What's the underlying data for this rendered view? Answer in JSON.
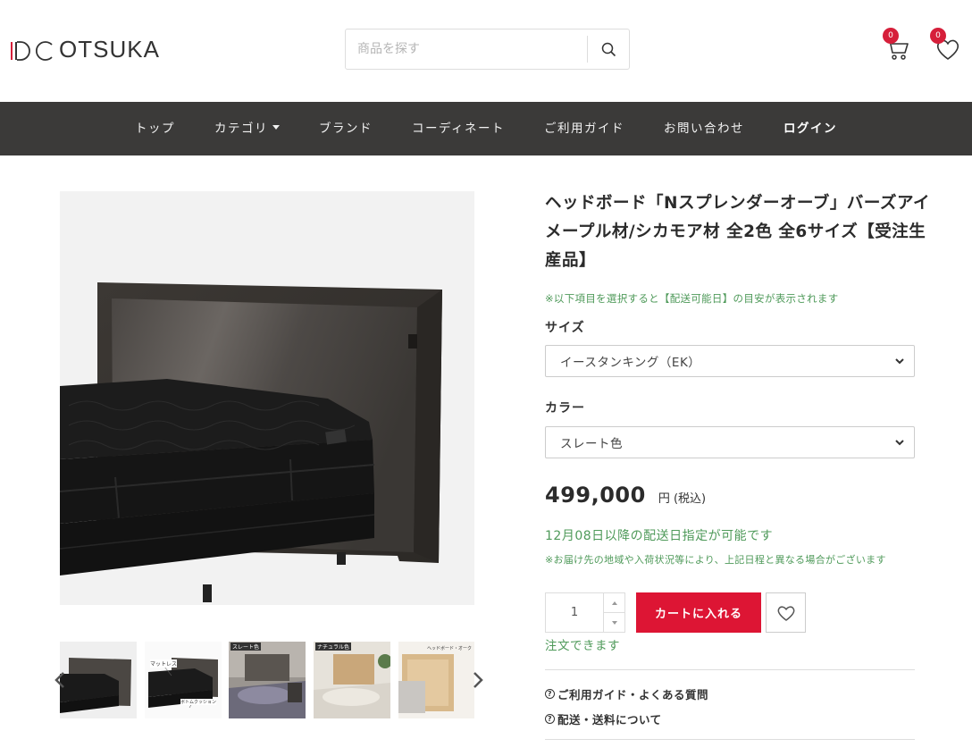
{
  "header": {
    "logo_mark": "IDC",
    "logo_text": "OTSUKA",
    "search_placeholder": "商品を探す",
    "cart_count": "0",
    "favorites_count": "0"
  },
  "nav": {
    "items": [
      "トップ",
      "カテゴリ",
      "ブランド",
      "コーディネート",
      "ご利用ガイド",
      "お問い合わせ",
      "ログイン"
    ]
  },
  "gallery": {
    "thumb_labels": [
      "",
      "マットレス",
      "スレート色",
      "ナチュラル色",
      "ヘッドボード・オーク"
    ],
    "thumb_sub": "ボトムクッション"
  },
  "product": {
    "title": "ヘッドボード「Nスプレンダーオーブ」バーズアイメープル材/シカモア材 全2色 全6サイズ【受注生産品】",
    "select_note": "※以下項目を選択すると【配送可能日】の目安が表示されます",
    "size_label": "サイズ",
    "size_value": "イースタンキング（EK）",
    "color_label": "カラー",
    "color_value": "スレート色",
    "price": "499,000",
    "price_unit": "円 (税込)",
    "delivery_note": "12月08日以降の配送日指定が可能です",
    "delivery_subnote": "※お届け先の地域や入荷状況等により、上記日程と異なる場合がございます",
    "quantity": "1",
    "add_to_cart": "カートに入れる",
    "orderable": "注文できます",
    "guide_link": "ご利用ガイド・よくある質問",
    "shipping_link": "配送・送料について"
  },
  "colors": {
    "accent": "#dd1534",
    "nav_bg": "#3b3a39",
    "green": "#4f9a5a"
  }
}
